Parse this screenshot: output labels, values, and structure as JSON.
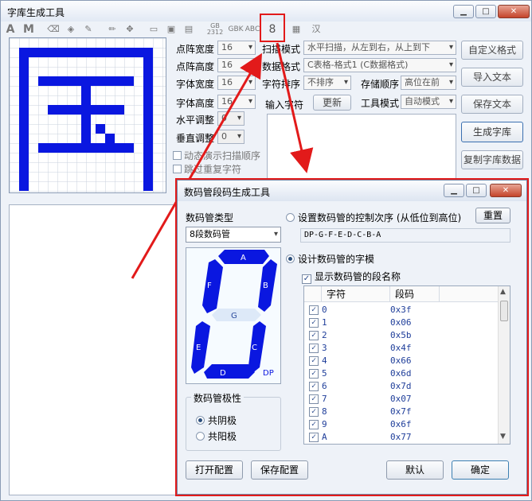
{
  "window": {
    "title": "字库生成工具"
  },
  "toolbar": {
    "gb_label": "GB\n2312",
    "gbk_label": "GBK",
    "abc_label": "ABC",
    "eight_label": "8",
    "han_label": "汉"
  },
  "settings": {
    "dot_width_label": "点阵宽度",
    "dot_width_value": "16",
    "dot_height_label": "点阵高度",
    "dot_height_value": "16",
    "font_width_label": "字体宽度",
    "font_width_value": "16",
    "font_height_label": "字体高度",
    "font_height_value": "16",
    "h_adjust_label": "水平调整",
    "h_adjust_value": "0",
    "v_adjust_label": "垂直调整",
    "v_adjust_value": "0",
    "scan_mode_label": "扫描模式",
    "scan_mode_value": "水平扫描，从左到右，从上到下",
    "data_format_label": "数据格式",
    "data_format_value": "C表格-格式1 (C数据格式)",
    "char_sort_label": "字符排序",
    "char_sort_value": "不排序",
    "store_order_label": "存储顺序",
    "store_order_value": "高位在前",
    "input_char_label": "输入字符",
    "update_button": "更新",
    "tool_mode_label": "工具模式",
    "tool_mode_value": "自动模式",
    "anim_scan_label": "动态演示扫描顺序",
    "skip_dup_label": "跳过重复字符"
  },
  "side_buttons": [
    "自定义格式",
    "导入文本",
    "保存文本",
    "生成字库",
    "复制字库数据"
  ],
  "dialog": {
    "title": "数码管段码生成工具",
    "seg_type_label": "数码管类型",
    "seg_type_value": "8段数码管",
    "control_order_label": "设置数码管的控制次序 (从低位到高位)",
    "reset_button": "重置",
    "order_value": "DP-G-F-E-D-C-B-A",
    "design_label": "设计数码管的字模",
    "show_names_label": "显示数码管的段名称",
    "polarity_label": "数码管极性",
    "common_cathode": "共阴极",
    "common_anode": "共阳极",
    "col_char": "字符",
    "col_code": "段码",
    "segments": {
      "a": "A",
      "b": "B",
      "c": "C",
      "d": "D",
      "e": "E",
      "f": "F",
      "g": "G",
      "dp": "DP"
    },
    "rows": [
      {
        "char": "0",
        "code": "0x3f"
      },
      {
        "char": "1",
        "code": "0x06"
      },
      {
        "char": "2",
        "code": "0x5b"
      },
      {
        "char": "3",
        "code": "0x4f"
      },
      {
        "char": "4",
        "code": "0x66"
      },
      {
        "char": "5",
        "code": "0x6d"
      },
      {
        "char": "6",
        "code": "0x7d"
      },
      {
        "char": "7",
        "code": "0x07"
      },
      {
        "char": "8",
        "code": "0x7f"
      },
      {
        "char": "9",
        "code": "0x6f"
      },
      {
        "char": "A",
        "code": "0x77"
      }
    ],
    "open_config": "打开配置",
    "save_config": "保存配置",
    "default_button": "默认",
    "ok_button": "确定"
  }
}
